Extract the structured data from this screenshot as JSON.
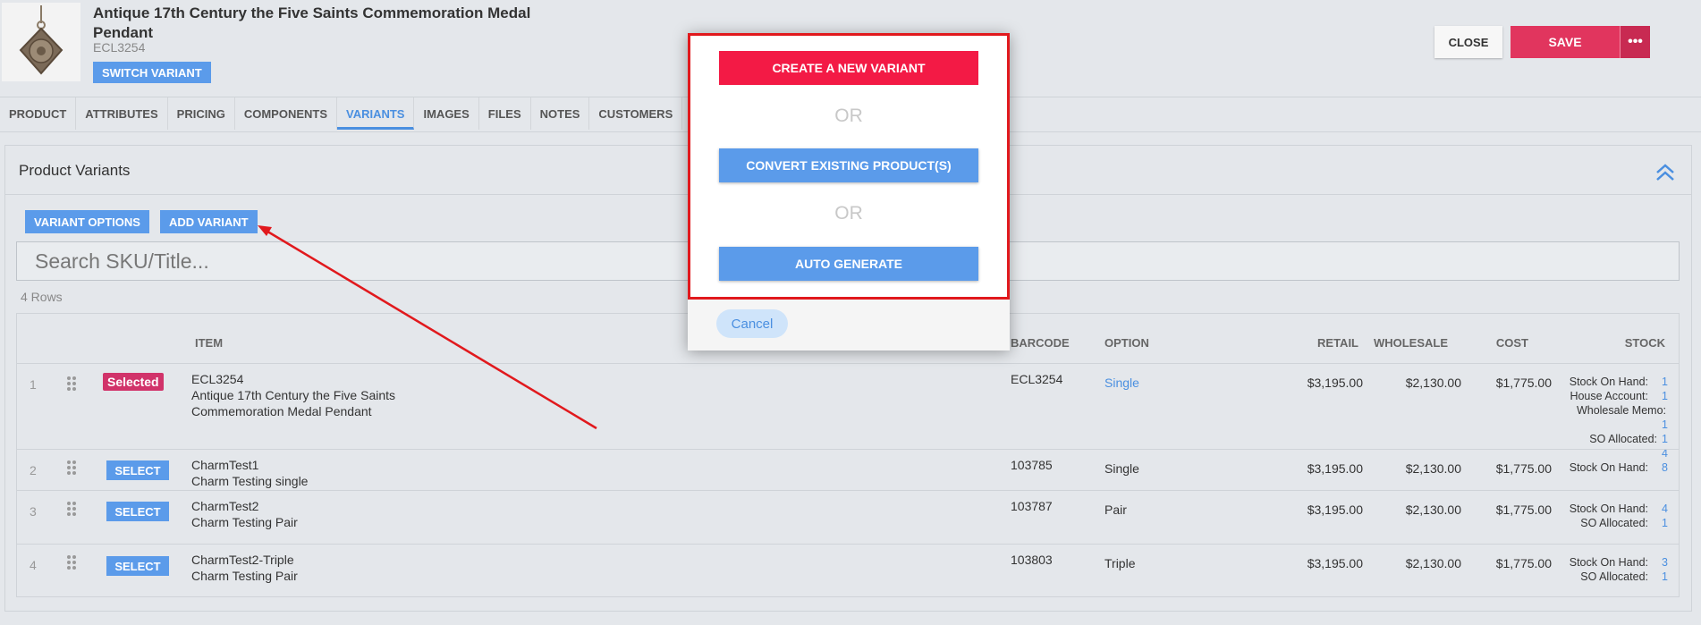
{
  "product": {
    "title": "Antique 17th Century the Five Saints Commemoration Medal Pendant",
    "sku": "ECL3254",
    "switch_label": "SWITCH VARIANT"
  },
  "header": {
    "close_label": "CLOSE",
    "save_label": "SAVE",
    "more_label": "•••"
  },
  "tabs": [
    {
      "label": "PRODUCT"
    },
    {
      "label": "ATTRIBUTES"
    },
    {
      "label": "PRICING"
    },
    {
      "label": "COMPONENTS"
    },
    {
      "label": "VARIANTS",
      "active": true
    },
    {
      "label": "IMAGES"
    },
    {
      "label": "FILES"
    },
    {
      "label": "NOTES"
    },
    {
      "label": "CUSTOMERS"
    }
  ],
  "panel": {
    "title": "Product Variants",
    "variant_options_label": "VARIANT OPTIONS",
    "add_variant_label": "ADD VARIANT",
    "search_placeholder": "Search SKU/Title...",
    "rows_count": "4 Rows"
  },
  "table": {
    "headers": {
      "item": "ITEM",
      "barcode": "BARCODE",
      "option": "OPTION",
      "retail": "RETAIL",
      "wholesale": "WHOLESALE",
      "cost": "COST",
      "stock": "STOCK"
    },
    "rows": [
      {
        "num": "1",
        "status": "Selected",
        "sku": "ECL3254",
        "title": "Antique 17th Century the Five Saints Commemoration Medal Pendant",
        "barcode": "ECL3254",
        "option": "Single",
        "retail": "$3,195.00",
        "wholesale": "$2,130.00",
        "cost": "$1,775.00",
        "stock": [
          {
            "label": "Stock On Hand:",
            "value": "1"
          },
          {
            "label": "House Account:",
            "value": "1"
          },
          {
            "label": "Wholesale Memo:",
            "value": ""
          },
          {
            "label": "",
            "value": "1"
          },
          {
            "label": "SO Allocated:",
            "value": "1"
          },
          {
            "label": "",
            "value": "4"
          }
        ]
      },
      {
        "num": "2",
        "status": "SELECT",
        "sku": "CharmTest1",
        "title": "Charm Testing single",
        "barcode": "103785",
        "option": "Single",
        "retail": "$3,195.00",
        "wholesale": "$2,130.00",
        "cost": "$1,775.00",
        "stock": [
          {
            "label": "Stock On Hand:",
            "value": "8"
          }
        ]
      },
      {
        "num": "3",
        "status": "SELECT",
        "sku": "CharmTest2",
        "title": "Charm Testing Pair",
        "barcode": "103787",
        "option": "Pair",
        "retail": "$3,195.00",
        "wholesale": "$2,130.00",
        "cost": "$1,775.00",
        "stock": [
          {
            "label": "Stock On Hand:",
            "value": "4"
          },
          {
            "label": "SO Allocated:",
            "value": "1"
          }
        ]
      },
      {
        "num": "4",
        "status": "SELECT",
        "sku": "CharmTest2-Triple",
        "title": "Charm Testing Pair",
        "barcode": "103803",
        "option": "Triple",
        "retail": "$3,195.00",
        "wholesale": "$2,130.00",
        "cost": "$1,775.00",
        "stock": [
          {
            "label": "Stock On Hand:",
            "value": "3"
          },
          {
            "label": "SO Allocated:",
            "value": "1"
          }
        ]
      }
    ]
  },
  "modal": {
    "create_label": "CREATE A NEW VARIANT",
    "or_label": "OR",
    "convert_label": "CONVERT EXISTING PRODUCT(S)",
    "auto_label": "AUTO GENERATE",
    "cancel_label": "Cancel"
  },
  "colors": {
    "primary_blue": "#5b9bea",
    "save_red": "#e1355e",
    "create_red": "#f31a45",
    "annotation_red": "#e1191d",
    "selected_badge": "#d1336a"
  }
}
